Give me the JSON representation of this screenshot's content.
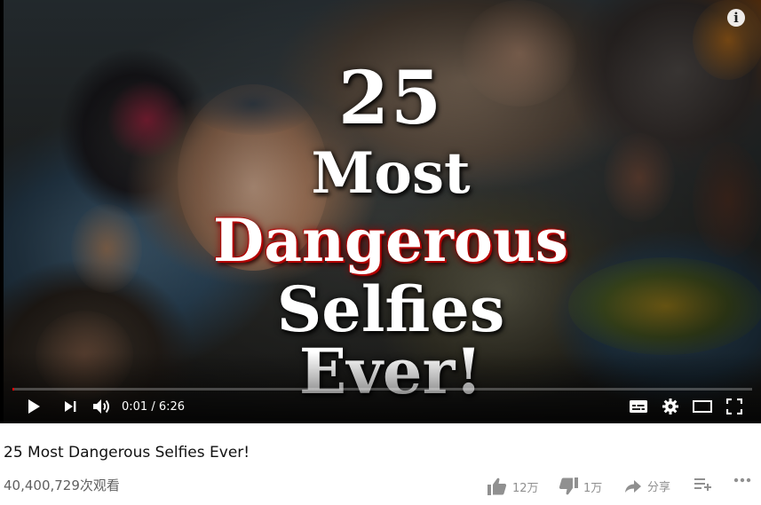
{
  "player": {
    "info_icon": "info-icon",
    "overlay": {
      "line1": "25",
      "line2": "Most",
      "line3": "Dangerous",
      "line4": "Selfies Ever!"
    },
    "time_display": "0:01 / 6:26",
    "progress_fraction": 0.0026,
    "progress_color": "#ff0000",
    "controls": {
      "play_icon": "play-icon",
      "next_icon": "next-icon",
      "volume_icon": "volume-icon",
      "subtitles_icon": "subtitles-icon",
      "settings_icon": "settings-icon",
      "theater_icon": "theater-mode-icon",
      "fullscreen_icon": "fullscreen-icon"
    }
  },
  "video": {
    "title": "25 Most Dangerous Selfies Ever!",
    "views": "40,400,729次观看"
  },
  "actions": {
    "like_count": "12万",
    "dislike_count": "1万",
    "share_label": "分享",
    "add_to_playlist_icon": "add-to-playlist-icon",
    "more_icon": "more-icon"
  }
}
